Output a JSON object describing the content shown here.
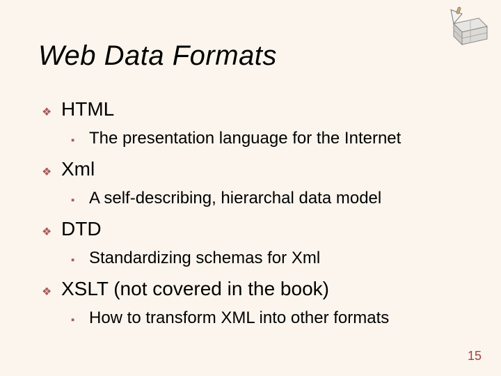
{
  "title": "Web Data Formats",
  "bullets": {
    "diamond": "❖",
    "square": "▪"
  },
  "items": [
    {
      "label": "HTML",
      "sub": "The presentation language for the Internet"
    },
    {
      "label": "Xml",
      "sub": "A self-describing, hierarchal data model"
    },
    {
      "label": "DTD",
      "sub": "Standardizing schemas for Xml"
    },
    {
      "label": "XSLT (not covered in the book)",
      "sub": "How to transform XML into other formats"
    }
  ],
  "page_number": "15"
}
